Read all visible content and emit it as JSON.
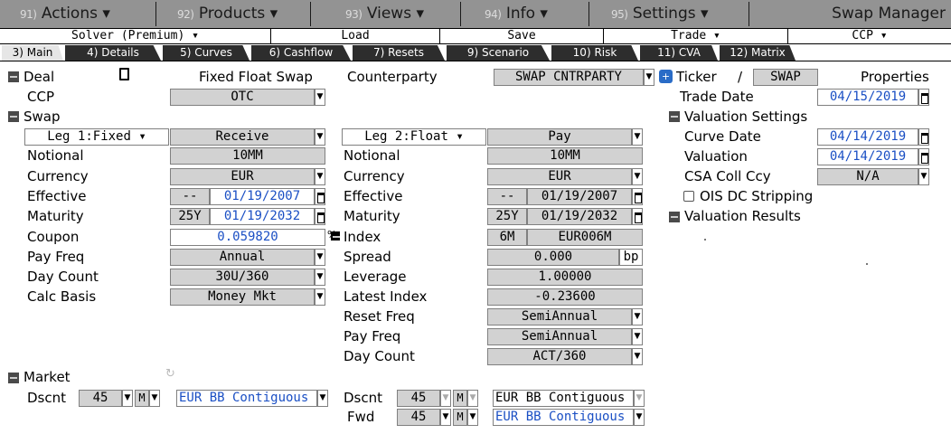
{
  "menubar": {
    "items": [
      {
        "num": "91)",
        "label": "Actions ▾"
      },
      {
        "num": "92)",
        "label": "Products ▾"
      },
      {
        "num": "93)",
        "label": "Views ▾"
      },
      {
        "num": "94)",
        "label": "Info ▾"
      },
      {
        "num": "95)",
        "label": "Settings ▾"
      }
    ],
    "title": "Swap Manager"
  },
  "bar2": {
    "solver": "Solver (Premium) ▾",
    "load": "Load",
    "save": "Save",
    "trade": "Trade ▾",
    "ccp": "CCP ▾"
  },
  "tabs": [
    "3) Main",
    "4) Details",
    "5) Curves",
    "6) Cashflow",
    "7) Resets",
    "9) Scenario",
    "10) Risk",
    "11) CVA",
    "12) Matrix"
  ],
  "deal": {
    "header": "Deal",
    "type": "Fixed Float Swap",
    "counterparty_label": "Counterparty",
    "counterparty_value": "SWAP CNTRPARTY",
    "ticker_label": "Ticker",
    "ticker_sep": "/",
    "ticker_value": "SWAP",
    "properties": "Properties",
    "ccp_label": "CCP",
    "ccp_value": "OTC",
    "trade_date_label": "Trade Date",
    "trade_date_value": "04/15/2019"
  },
  "swap": {
    "header": "Swap",
    "leg1": {
      "selector": "Leg 1:Fixed ▾",
      "direction": "Receive",
      "rows": [
        {
          "label": "Notional",
          "value": "10MM"
        },
        {
          "label": "Currency",
          "value": "EUR"
        },
        {
          "label": "Effective",
          "prefix": "--",
          "value": "01/19/2007"
        },
        {
          "label": "Maturity",
          "prefix": "25Y",
          "value": "01/19/2032"
        },
        {
          "label": "Coupon",
          "value": "0.059820",
          "unit": "%"
        },
        {
          "label": "Pay Freq",
          "value": "Annual"
        },
        {
          "label": "Day Count",
          "value": "30U/360"
        },
        {
          "label": "Calc Basis",
          "value": "Money Mkt"
        }
      ]
    },
    "leg2": {
      "selector": "Leg 2:Float ▾",
      "direction": "Pay",
      "rows": [
        {
          "label": "Notional",
          "value": "10MM"
        },
        {
          "label": "Currency",
          "value": "EUR"
        },
        {
          "label": "Effective",
          "prefix": "--",
          "value": "01/19/2007"
        },
        {
          "label": "Maturity",
          "prefix": "25Y",
          "value": "01/19/2032"
        },
        {
          "label": "Index",
          "prefix": "6M",
          "value": "EUR006M"
        },
        {
          "label": "Spread",
          "value": "0.000",
          "unit": "bp"
        },
        {
          "label": "Leverage",
          "value": "1.00000"
        },
        {
          "label": "Latest Index",
          "value": "-0.23600"
        },
        {
          "label": "Reset Freq",
          "value": "SemiAnnual"
        },
        {
          "label": "Pay Freq",
          "value": "SemiAnnual"
        },
        {
          "label": "Day Count",
          "value": "ACT/360"
        }
      ]
    }
  },
  "valuation_settings": {
    "header": "Valuation Settings",
    "curve_date_label": "Curve Date",
    "curve_date_value": "04/14/2019",
    "valuation_label": "Valuation",
    "valuation_value": "04/14/2019",
    "csa_label": "CSA Coll Ccy",
    "csa_value": "N/A",
    "ois_label": "OIS DC Stripping"
  },
  "valuation_results": {
    "header": "Valuation Results"
  },
  "market": {
    "header": "Market",
    "leg1": {
      "label": "Dscnt",
      "num": "45",
      "m": "M",
      "curve": "EUR BB Contiguous"
    },
    "leg2_dscnt": {
      "label": "Dscnt",
      "num": "45",
      "m": "M",
      "curve": "EUR BB Contiguous"
    },
    "leg2_fwd": {
      "label": "Fwd",
      "num": "45",
      "m": "M",
      "curve": "EUR BB Contiguous"
    }
  },
  "colors": {
    "menubar": "#939393",
    "tab_dark": "#2d2d2d",
    "blue_text": "#1a4fc4",
    "field_grey": "#d2d2d2"
  }
}
